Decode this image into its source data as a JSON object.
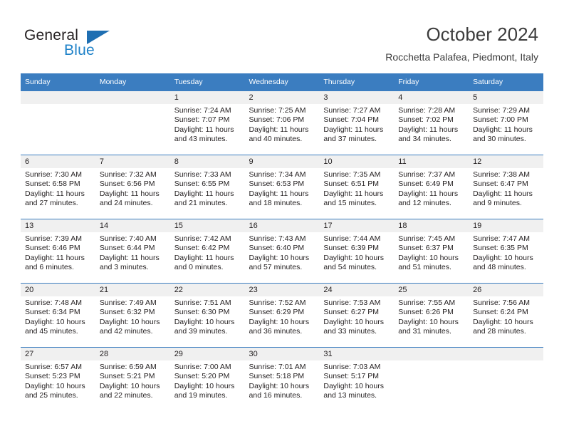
{
  "brand": {
    "name_top": "General",
    "name_bottom": "Blue",
    "triangle_color": "#1f6fb2",
    "blue_text_color": "#1f82c8"
  },
  "header": {
    "title": "October 2024",
    "subtitle": "Rocchetta Palafea, Piedmont, Italy"
  },
  "theme": {
    "header_blue": "#3b7dc0",
    "daynum_band": "#f0f0f0",
    "text": "#231f20"
  },
  "calendar": {
    "weekday_headers": [
      "Sunday",
      "Monday",
      "Tuesday",
      "Wednesday",
      "Thursday",
      "Friday",
      "Saturday"
    ],
    "weeks": [
      [
        {
          "day": "",
          "sunrise": "",
          "sunset": "",
          "daylight": ""
        },
        {
          "day": "",
          "sunrise": "",
          "sunset": "",
          "daylight": ""
        },
        {
          "day": "1",
          "sunrise": "Sunrise: 7:24 AM",
          "sunset": "Sunset: 7:07 PM",
          "daylight": "Daylight: 11 hours and 43 minutes."
        },
        {
          "day": "2",
          "sunrise": "Sunrise: 7:25 AM",
          "sunset": "Sunset: 7:06 PM",
          "daylight": "Daylight: 11 hours and 40 minutes."
        },
        {
          "day": "3",
          "sunrise": "Sunrise: 7:27 AM",
          "sunset": "Sunset: 7:04 PM",
          "daylight": "Daylight: 11 hours and 37 minutes."
        },
        {
          "day": "4",
          "sunrise": "Sunrise: 7:28 AM",
          "sunset": "Sunset: 7:02 PM",
          "daylight": "Daylight: 11 hours and 34 minutes."
        },
        {
          "day": "5",
          "sunrise": "Sunrise: 7:29 AM",
          "sunset": "Sunset: 7:00 PM",
          "daylight": "Daylight: 11 hours and 30 minutes."
        }
      ],
      [
        {
          "day": "6",
          "sunrise": "Sunrise: 7:30 AM",
          "sunset": "Sunset: 6:58 PM",
          "daylight": "Daylight: 11 hours and 27 minutes."
        },
        {
          "day": "7",
          "sunrise": "Sunrise: 7:32 AM",
          "sunset": "Sunset: 6:56 PM",
          "daylight": "Daylight: 11 hours and 24 minutes."
        },
        {
          "day": "8",
          "sunrise": "Sunrise: 7:33 AM",
          "sunset": "Sunset: 6:55 PM",
          "daylight": "Daylight: 11 hours and 21 minutes."
        },
        {
          "day": "9",
          "sunrise": "Sunrise: 7:34 AM",
          "sunset": "Sunset: 6:53 PM",
          "daylight": "Daylight: 11 hours and 18 minutes."
        },
        {
          "day": "10",
          "sunrise": "Sunrise: 7:35 AM",
          "sunset": "Sunset: 6:51 PM",
          "daylight": "Daylight: 11 hours and 15 minutes."
        },
        {
          "day": "11",
          "sunrise": "Sunrise: 7:37 AM",
          "sunset": "Sunset: 6:49 PM",
          "daylight": "Daylight: 11 hours and 12 minutes."
        },
        {
          "day": "12",
          "sunrise": "Sunrise: 7:38 AM",
          "sunset": "Sunset: 6:47 PM",
          "daylight": "Daylight: 11 hours and 9 minutes."
        }
      ],
      [
        {
          "day": "13",
          "sunrise": "Sunrise: 7:39 AM",
          "sunset": "Sunset: 6:46 PM",
          "daylight": "Daylight: 11 hours and 6 minutes."
        },
        {
          "day": "14",
          "sunrise": "Sunrise: 7:40 AM",
          "sunset": "Sunset: 6:44 PM",
          "daylight": "Daylight: 11 hours and 3 minutes."
        },
        {
          "day": "15",
          "sunrise": "Sunrise: 7:42 AM",
          "sunset": "Sunset: 6:42 PM",
          "daylight": "Daylight: 11 hours and 0 minutes."
        },
        {
          "day": "16",
          "sunrise": "Sunrise: 7:43 AM",
          "sunset": "Sunset: 6:40 PM",
          "daylight": "Daylight: 10 hours and 57 minutes."
        },
        {
          "day": "17",
          "sunrise": "Sunrise: 7:44 AM",
          "sunset": "Sunset: 6:39 PM",
          "daylight": "Daylight: 10 hours and 54 minutes."
        },
        {
          "day": "18",
          "sunrise": "Sunrise: 7:45 AM",
          "sunset": "Sunset: 6:37 PM",
          "daylight": "Daylight: 10 hours and 51 minutes."
        },
        {
          "day": "19",
          "sunrise": "Sunrise: 7:47 AM",
          "sunset": "Sunset: 6:35 PM",
          "daylight": "Daylight: 10 hours and 48 minutes."
        }
      ],
      [
        {
          "day": "20",
          "sunrise": "Sunrise: 7:48 AM",
          "sunset": "Sunset: 6:34 PM",
          "daylight": "Daylight: 10 hours and 45 minutes."
        },
        {
          "day": "21",
          "sunrise": "Sunrise: 7:49 AM",
          "sunset": "Sunset: 6:32 PM",
          "daylight": "Daylight: 10 hours and 42 minutes."
        },
        {
          "day": "22",
          "sunrise": "Sunrise: 7:51 AM",
          "sunset": "Sunset: 6:30 PM",
          "daylight": "Daylight: 10 hours and 39 minutes."
        },
        {
          "day": "23",
          "sunrise": "Sunrise: 7:52 AM",
          "sunset": "Sunset: 6:29 PM",
          "daylight": "Daylight: 10 hours and 36 minutes."
        },
        {
          "day": "24",
          "sunrise": "Sunrise: 7:53 AM",
          "sunset": "Sunset: 6:27 PM",
          "daylight": "Daylight: 10 hours and 33 minutes."
        },
        {
          "day": "25",
          "sunrise": "Sunrise: 7:55 AM",
          "sunset": "Sunset: 6:26 PM",
          "daylight": "Daylight: 10 hours and 31 minutes."
        },
        {
          "day": "26",
          "sunrise": "Sunrise: 7:56 AM",
          "sunset": "Sunset: 6:24 PM",
          "daylight": "Daylight: 10 hours and 28 minutes."
        }
      ],
      [
        {
          "day": "27",
          "sunrise": "Sunrise: 6:57 AM",
          "sunset": "Sunset: 5:23 PM",
          "daylight": "Daylight: 10 hours and 25 minutes."
        },
        {
          "day": "28",
          "sunrise": "Sunrise: 6:59 AM",
          "sunset": "Sunset: 5:21 PM",
          "daylight": "Daylight: 10 hours and 22 minutes."
        },
        {
          "day": "29",
          "sunrise": "Sunrise: 7:00 AM",
          "sunset": "Sunset: 5:20 PM",
          "daylight": "Daylight: 10 hours and 19 minutes."
        },
        {
          "day": "30",
          "sunrise": "Sunrise: 7:01 AM",
          "sunset": "Sunset: 5:18 PM",
          "daylight": "Daylight: 10 hours and 16 minutes."
        },
        {
          "day": "31",
          "sunrise": "Sunrise: 7:03 AM",
          "sunset": "Sunset: 5:17 PM",
          "daylight": "Daylight: 10 hours and 13 minutes."
        },
        {
          "day": "",
          "sunrise": "",
          "sunset": "",
          "daylight": ""
        },
        {
          "day": "",
          "sunrise": "",
          "sunset": "",
          "daylight": ""
        }
      ]
    ]
  }
}
